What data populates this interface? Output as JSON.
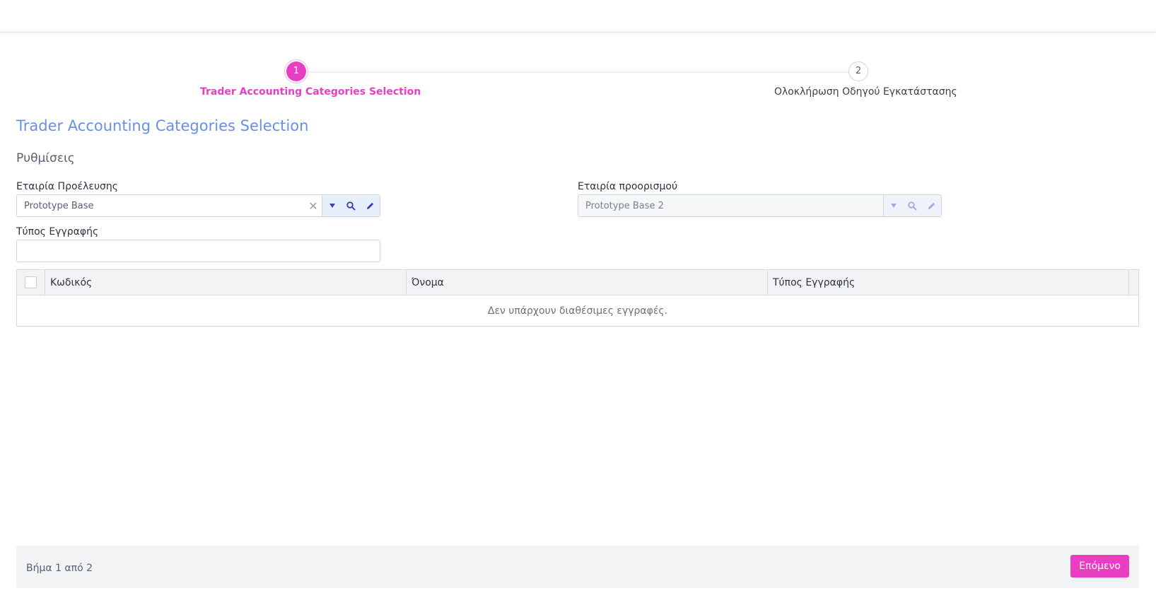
{
  "stepper": {
    "steps": [
      {
        "number": "1",
        "label": "Trader Accounting Categories Selection"
      },
      {
        "number": "2",
        "label": "Ολοκλήρωση Οδηγού Εγκατάστασης"
      }
    ]
  },
  "page": {
    "title": "Trader Accounting Categories Selection",
    "section": "Ρυθμίσεις"
  },
  "form": {
    "source_company": {
      "label": "Εταιρία Προέλευσης",
      "value": "Prototype Base"
    },
    "target_company": {
      "label": "Εταιρία προορισμού",
      "value": "Prototype Base 2"
    },
    "record_type": {
      "label": "Τύπος Εγγραφής",
      "value": ""
    }
  },
  "grid": {
    "columns": [
      "Κωδικός",
      "Όνομα",
      "Τύπος Εγγραφής"
    ],
    "empty_message": "Δεν υπάρχουν διαθέσιμες εγγραφές."
  },
  "footer": {
    "step_text": "Βήμα 1 από 2",
    "next_label": "Επόμενο"
  },
  "colors": {
    "accent": "#e83fc2",
    "title": "#6a8fe0"
  }
}
